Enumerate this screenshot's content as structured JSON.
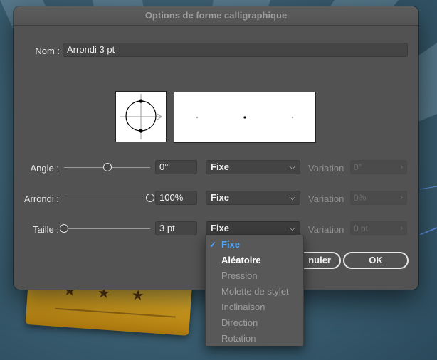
{
  "dialog": {
    "title": "Options de forme calligraphique",
    "name_label": "Nom :",
    "name_value": "Arrondi 3 pt"
  },
  "rows": [
    {
      "label": "Angle :",
      "value": "0°",
      "mode": "Fixe",
      "variation_label": "Variation",
      "variation_value": "0°",
      "slider_level": 0.5
    },
    {
      "label": "Arrondi :",
      "value": "100%",
      "mode": "Fixe",
      "variation_label": "Variation",
      "variation_value": "0%",
      "slider_level": 1.0
    },
    {
      "label": "Taille :",
      "value": "3 pt",
      "mode": "Fixe",
      "variation_label": "Variation",
      "variation_value": "0 pt",
      "slider_level": 0.0
    }
  ],
  "buttons": {
    "cancel_label": "nuler",
    "ok_label": "OK"
  },
  "dropdown": {
    "items": [
      {
        "label": "Fixe",
        "state": "selected"
      },
      {
        "label": "Aléatoire",
        "state": "enabled"
      },
      {
        "label": "Pression",
        "state": "disabled"
      },
      {
        "label": "Molette de stylet",
        "state": "disabled"
      },
      {
        "label": "Inclinaison",
        "state": "disabled"
      },
      {
        "label": "Direction",
        "state": "disabled"
      },
      {
        "label": "Rotation",
        "state": "disabled"
      }
    ]
  },
  "icons": {
    "checkmark": "checkmark-icon",
    "chevron": "chevron-down-icon",
    "stepper": "chevron-right-icon"
  },
  "colors": {
    "dialog_bg": "#525252",
    "accent": "#4da6ff"
  }
}
